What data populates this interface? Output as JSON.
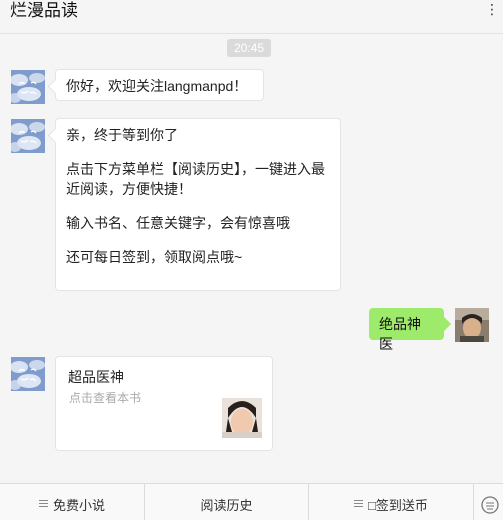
{
  "header": {
    "title": "烂漫品读",
    "more_icon": "more-dots-icon"
  },
  "chat": {
    "timestamp": "20:45",
    "messages": {
      "m1": {
        "text": "你好，欢迎关注langmanpd！"
      },
      "m2": {
        "line1": "亲，终于等到你了",
        "line2": "点击下方菜单栏【阅读历史】，一键进入最近阅读，方便快捷！",
        "line3": "输入书名、任意关键字，会有惊喜哦",
        "line4": "还可每日签到，领取阅点哦~"
      },
      "m3": {
        "text": "绝品神医"
      },
      "m4": {
        "title": "超品医神",
        "desc": "点击查看本书"
      }
    },
    "account_avatar_text": "烂漫品读",
    "colors": {
      "user_bubble": "#9eea6a",
      "background": "#f5f5f5",
      "avatar_sky": "#6f8fbf"
    }
  },
  "menu": {
    "items": [
      {
        "label": "免费小说",
        "icon": "menu-lines-icon"
      },
      {
        "label": "阅读历史"
      },
      {
        "label": "□签到送币",
        "icon": "menu-lines-icon"
      }
    ],
    "keyboard_icon": "keyboard-toggle-icon"
  }
}
